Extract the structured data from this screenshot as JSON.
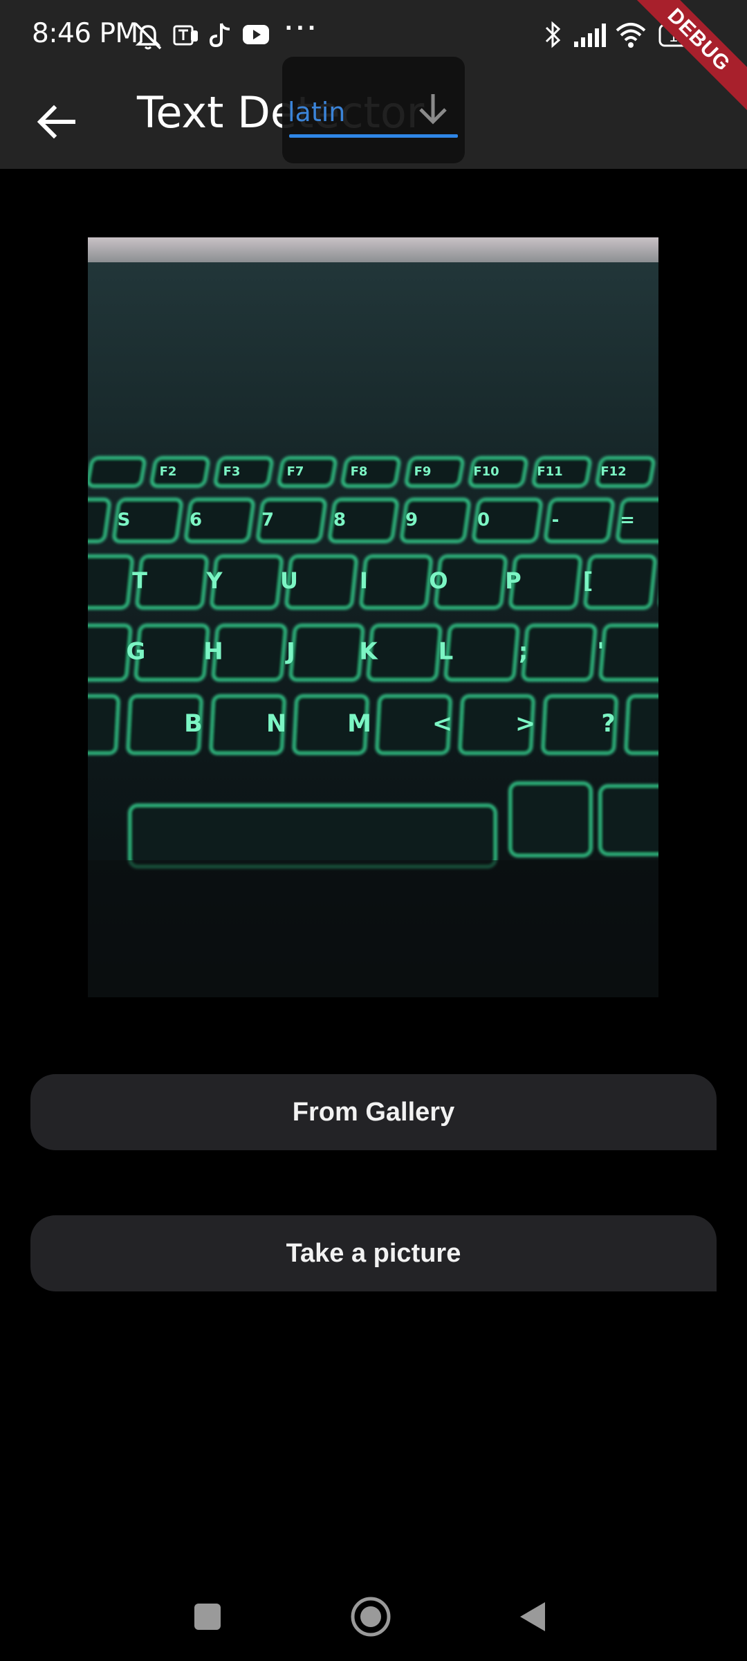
{
  "status_bar": {
    "time": "8:46 PM",
    "battery": "100",
    "icons": [
      "mute-icon",
      "teams-icon",
      "tiktok-icon",
      "youtube-icon",
      "more-dots-icon",
      "bluetooth-icon",
      "signal-icon",
      "wifi-icon",
      "battery-icon"
    ]
  },
  "app_bar": {
    "title": "Text Detector",
    "back_icon": "arrow-back-icon"
  },
  "script_dropdown": {
    "selected": "latin",
    "arrow_icon": "arrow-down-icon"
  },
  "debug_banner": "DEBUG",
  "buttons": {
    "gallery": "From Gallery",
    "camera": "Take a picture"
  },
  "nav_bar": {
    "icons": [
      "recents-square-icon",
      "home-circle-icon",
      "back-triangle-icon"
    ]
  },
  "colors": {
    "bar_bg": "#242424",
    "accent": "#2f86e6",
    "button_bg": "#232326",
    "keyboard_glow": "#3ce8a0"
  }
}
